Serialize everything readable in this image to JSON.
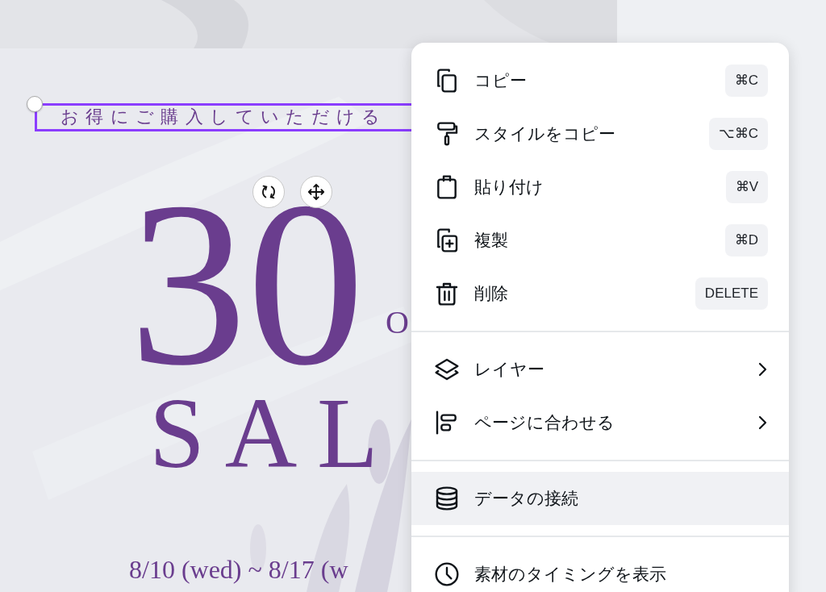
{
  "canvas": {
    "texts": [
      {
        "kind": "subtitle",
        "text": "お得にご購入していただける",
        "selected": true
      },
      {
        "kind": "numeral",
        "text": "30",
        "selected": false
      },
      {
        "kind": "off",
        "text": "O",
        "selected": false
      },
      {
        "kind": "sale",
        "text": "SAL",
        "selected": false
      },
      {
        "kind": "date",
        "text": "8/10 (wed) ~ 8/17 (w",
        "selected": false
      }
    ]
  },
  "context_menu": {
    "sections": [
      [
        {
          "kind": "shortcut",
          "label": "コピー",
          "shortcut": "⌘C",
          "highlighted": false
        },
        {
          "kind": "shortcut",
          "label": "スタイルをコピー",
          "shortcut": "⌥⌘C",
          "highlighted": false
        },
        {
          "kind": "shortcut",
          "label": "貼り付け",
          "shortcut": "⌘V",
          "highlighted": false
        },
        {
          "kind": "shortcut",
          "label": "複製",
          "shortcut": "⌘D",
          "highlighted": false
        },
        {
          "kind": "shortcut",
          "label": "削除",
          "shortcut": "DELETE",
          "highlighted": false
        }
      ],
      [
        {
          "kind": "submenu",
          "label": "レイヤー",
          "highlighted": false
        },
        {
          "kind": "submenu",
          "label": "ページに合わせる",
          "highlighted": false
        }
      ],
      [
        {
          "kind": "plain",
          "label": "データの接続",
          "highlighted": true
        }
      ],
      [
        {
          "kind": "plain",
          "label": "素材のタイミングを表示",
          "highlighted": false
        }
      ]
    ]
  }
}
